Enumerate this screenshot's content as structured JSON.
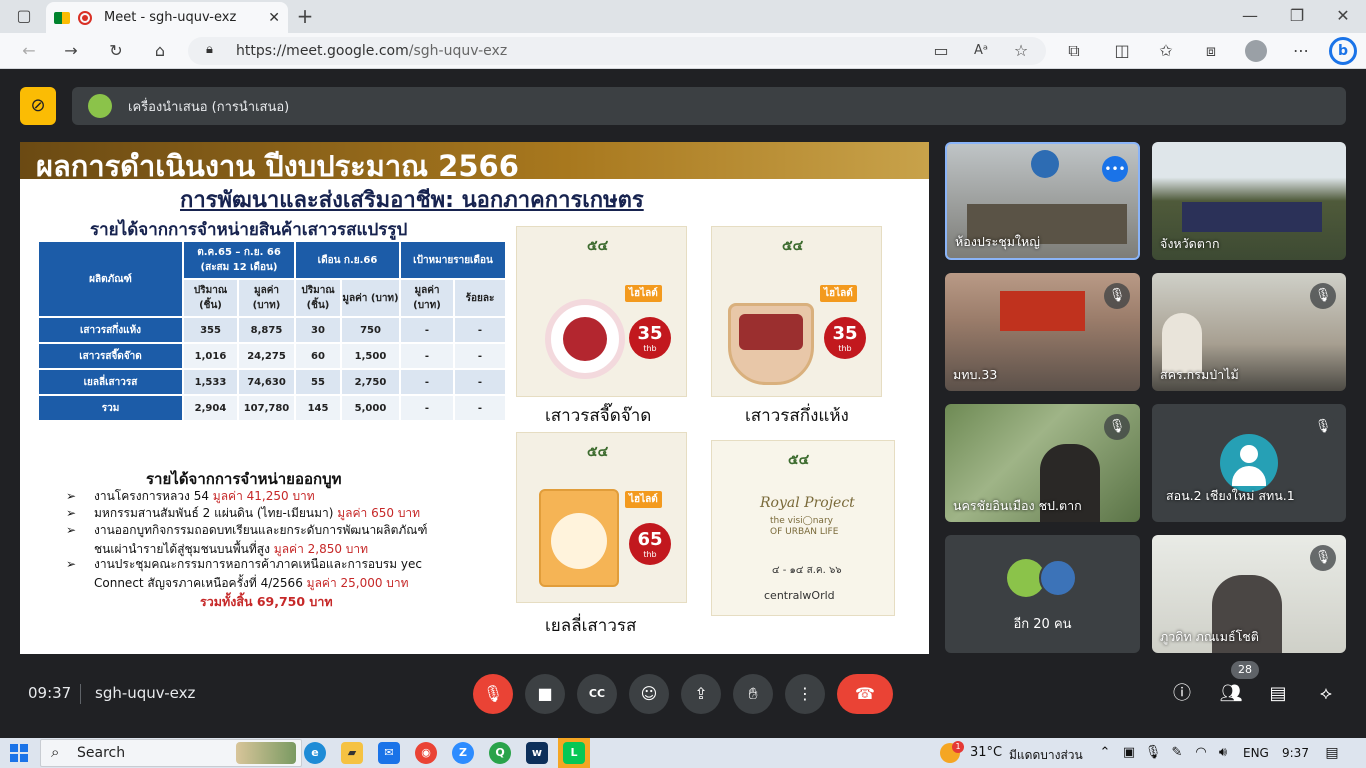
{
  "browser": {
    "tab_title": "Meet - sgh-uquv-exz",
    "url_full": "https://meet.google.com/sgh-uquv-exz",
    "url_host": "https://meet.google.com",
    "url_path": "/sgh-uquv-exz"
  },
  "meet": {
    "presenter_label": "เครื่องนำเสนอ (การนำเสนอ)",
    "time": "09:37",
    "meeting_code": "sgh-uquv-exz",
    "participant_count": "28"
  },
  "slide": {
    "title": "ผลการดำเนินงาน ปีงบประมาณ 2566",
    "subtitle": "การพัฒนาและส่งเสริมอาชีพ: นอกภาคการเกษตร",
    "heading1": "รายได้จากการจำหน่ายสินค้าเสาวรสแปรรูป",
    "table": {
      "col_product": "ผลิตภัณฑ์",
      "group1": "ต.ค.65 – ก.ย. 66 (สะสม 12 เดือน)",
      "group2": "เดือน ก.ย.66",
      "group3": "เป้าหมายรายเดือน",
      "sub": [
        "ปริมาณ (ชิ้น)",
        "มูลค่า (บาท)",
        "ปริมาณ (ชิ้น)",
        "มูลค่า (บาท)",
        "มูลค่า (บาท)",
        "ร้อยละ"
      ],
      "rows": [
        [
          "เสาวรสกึ่งแห้ง",
          "355",
          "8,875",
          "30",
          "750",
          "-",
          "-"
        ],
        [
          "เสาวรสจี๊ดจ๊าด",
          "1,016",
          "24,275",
          "60",
          "1,500",
          "-",
          "-"
        ],
        [
          "เยลลี่เสาวรส",
          "1,533",
          "74,630",
          "55",
          "2,750",
          "-",
          "-"
        ],
        [
          "รวม",
          "2,904",
          "107,780",
          "145",
          "5,000",
          "-",
          "-"
        ]
      ]
    },
    "heading2": "รายได้จากการจำหน่ายออกบูท",
    "bullets": [
      {
        "text": "งานโครงการหลวง 54 ",
        "money": "มูลค่า 41,250 บาท"
      },
      {
        "text": "มหกรรมสานสัมพันธ์ 2 แผ่นดิน (ไทย-เมียนมา) ",
        "money": "มูลค่า 650 บาท"
      },
      {
        "text": "งานออกบูทกิจกรรมถอดบทเรียนและยกระดับการพัฒนาผลิตภัณฑ์",
        "text2": "ชนเผ่านำรายได้สู่ชุมชนบนพื้นที่สูง ",
        "money": "มูลค่า 2,850 บาท"
      },
      {
        "text": "งานประชุมคณะกรรมการหอการค้าภาคเหนือและการอบรม yec",
        "text2": "Connect สัญจรภาคเหนือครั้งที่ 4/2566 ",
        "money": "มูลค่า 25,000 บาท"
      }
    ],
    "total": "รวมทั้งสิ้น 69,750 บาท",
    "products": [
      {
        "label": "เสาวรสจี๊ดจ๊าด",
        "price": "35",
        "unit": "thb",
        "badge": "ไฮไลต์",
        "logo": "๕๔"
      },
      {
        "label": "เสาวรสกึ่งแห้ง",
        "price": "35",
        "unit": "thb",
        "badge": "ไฮไลต์",
        "logo": "๕๔"
      },
      {
        "label": "เยลลี่เสาวรส",
        "price": "65",
        "unit": "thb",
        "badge": "ไฮไลต์",
        "logo": "๕๔"
      }
    ],
    "poster": {
      "line1": "Royal Project",
      "line2": "the visi◯nary",
      "line3": "OF URBAN LIFE",
      "date": "๔ - ๑๔ ส.ค. ๖๖",
      "brand": "centralwOrld",
      "logo": "๕๔"
    }
  },
  "participants": [
    {
      "name": "ห้องประชุมใหญ่",
      "speaking": true
    },
    {
      "name": "จังหวัดตาก",
      "speaking": false
    },
    {
      "name": "มทบ.33",
      "muted": true
    },
    {
      "name": "สคร.กรมป่าไม้",
      "muted": true
    },
    {
      "name": "นครชัยอินเมือง ชป.ตาก",
      "muted": true
    },
    {
      "name": "สอน.2 เชียงใหม่ สทน.1",
      "muted": true
    },
    {
      "name": "อีก 20 คน"
    },
    {
      "name": "ภูวดิท ภณเมธ์โชติ",
      "muted": true
    }
  ],
  "taskbar": {
    "search": "Search",
    "weather": "31°C",
    "weather_desc": "มีแดดบางส่วน",
    "lang": "ENG",
    "clock": "9:37",
    "weather_badge": "1"
  },
  "colors": {
    "accent_red": "#ea4335",
    "slide_blue": "#1c5ca8",
    "banner_gold": "#a8781e"
  }
}
